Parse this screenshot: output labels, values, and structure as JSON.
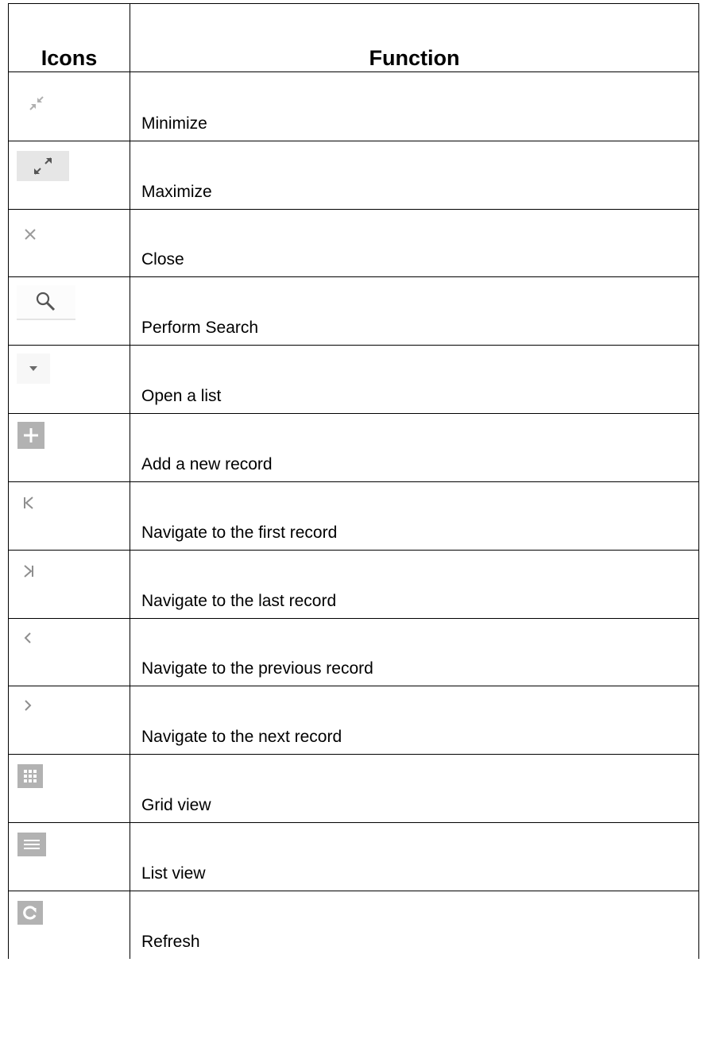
{
  "header": {
    "icons": "Icons",
    "function": "Function"
  },
  "rows": [
    {
      "icon": "minimize-icon",
      "label": "Minimize"
    },
    {
      "icon": "maximize-icon",
      "label": "Maximize"
    },
    {
      "icon": "close-icon",
      "label": "Close"
    },
    {
      "icon": "search-icon",
      "label": "Perform Search"
    },
    {
      "icon": "dropdown-arrow-icon",
      "label": "Open a list"
    },
    {
      "icon": "plus-icon",
      "label": "Add a new record"
    },
    {
      "icon": "first-record-icon",
      "label": "Navigate to the first record"
    },
    {
      "icon": "last-record-icon",
      "label": "Navigate to the last record"
    },
    {
      "icon": "previous-record-icon",
      "label": "Navigate to the previous record"
    },
    {
      "icon": "next-record-icon",
      "label": "Navigate to the next record"
    },
    {
      "icon": "grid-view-icon",
      "label": "Grid view"
    },
    {
      "icon": "list-view-icon",
      "label": "List view"
    },
    {
      "icon": "refresh-icon",
      "label": "Refresh"
    }
  ],
  "colors": {
    "border": "#000000",
    "icon_gray": "#a8a8a8",
    "icon_tile": "#b3b3b3"
  }
}
